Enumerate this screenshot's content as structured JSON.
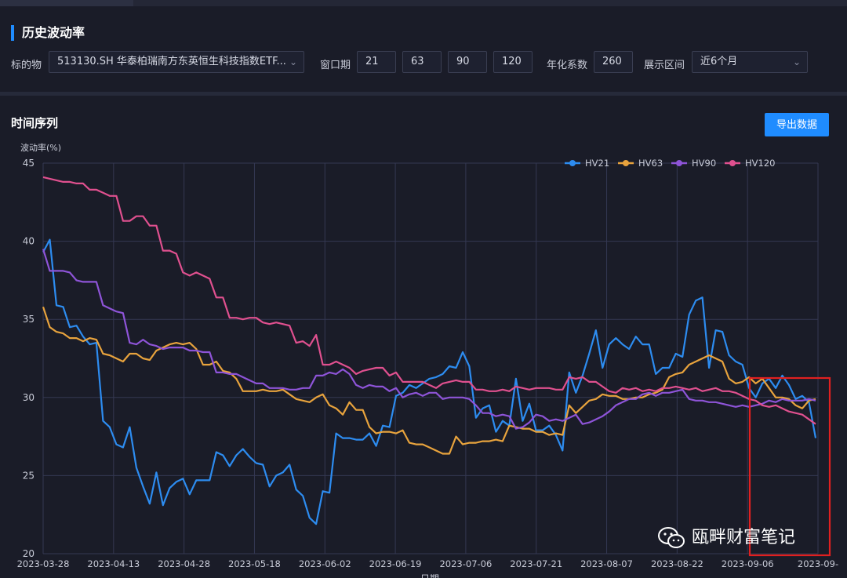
{
  "section": {
    "title": "历史波动率"
  },
  "filters": {
    "underlying_label": "标的物",
    "underlying_value": "513130.SH 华泰柏瑞南方东英恒生科技指数ETF...",
    "window_label": "窗口期",
    "windows": [
      "21",
      "63",
      "90",
      "120"
    ],
    "annual_label": "年化系数",
    "annual_value": "260",
    "range_label": "展示区间",
    "range_value": "近6个月"
  },
  "timeseries": {
    "title": "时间序列",
    "export_label": "导出数据"
  },
  "watermark": {
    "text": "瓯畔财富笔记"
  },
  "colors": {
    "accent": "#1f8cff",
    "hv21": "#2d8cf0",
    "hv63": "#e8a33d",
    "hv90": "#8e54d8",
    "hv120": "#e0508f",
    "highlight_box": "#e02020"
  },
  "chart_data": {
    "type": "line",
    "ylabel": "波动率(%)",
    "xlabel": "日期",
    "ylim": [
      20,
      45
    ],
    "yticks": [
      20,
      25,
      30,
      35,
      40,
      45
    ],
    "xtick_labels": [
      "2023-03-28",
      "2023-04-13",
      "2023-04-28",
      "2023-05-18",
      "2023-06-02",
      "2023-06-19",
      "2023-07-06",
      "2023-07-21",
      "2023-08-07",
      "2023-08-22",
      "2023-09-06",
      "2023-09-"
    ],
    "grid": true,
    "legend_position": "top-right",
    "x_count": 117,
    "series": [
      {
        "name": "HV21",
        "color": "#2d8cf0",
        "values": [
          39.3,
          40.1,
          35.9,
          35.8,
          34.5,
          34.6,
          33.9,
          33.4,
          33.5,
          28.5,
          28.1,
          27.0,
          26.8,
          28.1,
          25.5,
          24.3,
          23.2,
          25.2,
          23.1,
          24.2,
          24.6,
          24.8,
          23.8,
          24.7,
          24.7,
          24.7,
          26.5,
          26.3,
          25.6,
          26.3,
          26.7,
          26.2,
          25.8,
          25.7,
          24.3,
          25.0,
          25.2,
          25.7,
          24.1,
          23.7,
          22.3,
          21.9,
          24.0,
          23.9,
          27.7,
          27.4,
          27.4,
          27.3,
          27.3,
          27.7,
          26.9,
          28.2,
          28.1,
          30.1,
          30.3,
          30.8,
          30.6,
          30.9,
          31.2,
          31.3,
          31.5,
          32.0,
          31.9,
          32.9,
          32.0,
          28.7,
          29.3,
          29.5,
          27.8,
          28.5,
          28.2,
          31.2,
          28.5,
          29.6,
          27.9,
          27.9,
          28.2,
          27.6,
          26.6,
          31.6,
          30.3,
          31.4,
          32.8,
          34.3,
          31.9,
          33.4,
          33.8,
          33.4,
          33.1,
          33.9,
          33.4,
          33.4,
          31.5,
          31.9,
          31.9,
          32.8,
          32.6,
          35.3,
          36.2,
          36.4,
          31.9,
          34.3,
          34.2,
          32.7,
          32.3,
          32.1,
          30.6,
          30.0,
          30.9,
          31.2,
          30.6,
          31.4,
          30.8,
          29.9,
          30.1,
          29.7,
          27.4
        ]
      },
      {
        "name": "HV63",
        "color": "#e8a33d",
        "values": [
          35.8,
          34.5,
          34.2,
          34.1,
          33.8,
          33.8,
          33.6,
          33.8,
          33.7,
          32.8,
          32.7,
          32.5,
          32.3,
          32.8,
          32.8,
          32.5,
          32.4,
          33.0,
          33.2,
          33.4,
          33.5,
          33.4,
          33.5,
          33.1,
          32.1,
          32.1,
          32.3,
          31.7,
          31.6,
          31.2,
          30.4,
          30.4,
          30.4,
          30.5,
          30.4,
          30.4,
          30.5,
          30.2,
          29.9,
          29.8,
          29.7,
          30.0,
          30.2,
          29.5,
          29.3,
          28.9,
          29.7,
          29.2,
          29.2,
          28.1,
          27.7,
          27.8,
          27.8,
          27.7,
          27.9,
          27.1,
          27.0,
          27.0,
          26.8,
          26.6,
          26.4,
          26.4,
          27.5,
          27.0,
          27.1,
          27.1,
          27.2,
          27.2,
          27.3,
          27.2,
          28.2,
          28.1,
          28.0,
          28.0,
          27.8,
          27.8,
          27.6,
          27.7,
          27.6,
          29.5,
          29.0,
          29.4,
          29.8,
          29.9,
          30.2,
          30.1,
          30.1,
          29.9,
          29.9,
          30.0,
          30.0,
          30.2,
          30.3,
          30.5,
          31.3,
          31.5,
          31.6,
          32.1,
          32.3,
          32.5,
          32.7,
          32.5,
          32.3,
          31.2,
          30.9,
          31.0,
          31.3,
          30.9,
          31.2,
          30.6,
          30.0,
          30.0,
          29.9,
          29.5,
          29.3,
          29.8,
          29.9
        ]
      },
      {
        "name": "HV90",
        "color": "#8e54d8",
        "values": [
          39.5,
          38.1,
          38.1,
          38.1,
          38.0,
          37.5,
          37.4,
          37.4,
          37.4,
          35.9,
          35.7,
          35.5,
          35.4,
          33.5,
          33.4,
          33.7,
          33.4,
          33.3,
          33.1,
          33.2,
          33.2,
          33.2,
          33.0,
          33.0,
          32.9,
          32.9,
          31.6,
          31.6,
          31.5,
          31.5,
          31.3,
          31.1,
          30.9,
          30.9,
          30.6,
          30.6,
          30.6,
          30.5,
          30.5,
          30.6,
          30.6,
          31.4,
          31.4,
          31.6,
          31.5,
          31.8,
          31.5,
          30.8,
          30.6,
          30.8,
          30.7,
          30.7,
          30.4,
          30.6,
          30.0,
          30.2,
          30.3,
          30.1,
          30.3,
          30.3,
          29.9,
          30.0,
          30.0,
          30.0,
          29.9,
          29.5,
          29.0,
          29.0,
          28.8,
          28.9,
          28.8,
          28.0,
          28.1,
          28.4,
          28.9,
          28.8,
          28.5,
          28.6,
          28.5,
          28.7,
          28.9,
          28.3,
          28.4,
          28.6,
          28.8,
          29.1,
          29.5,
          29.7,
          29.9,
          29.9,
          30.2,
          30.3,
          30.1,
          30.3,
          30.3,
          30.4,
          30.5,
          29.9,
          29.8,
          29.8,
          29.7,
          29.7,
          29.6,
          29.5,
          29.4,
          29.5,
          29.4,
          29.5,
          29.6,
          29.8,
          29.7,
          29.9,
          29.8,
          29.8,
          29.8,
          29.9,
          29.8
        ]
      },
      {
        "name": "HV120",
        "color": "#e0508f",
        "values": [
          44.1,
          44.0,
          43.9,
          43.8,
          43.8,
          43.7,
          43.7,
          43.3,
          43.3,
          43.1,
          42.9,
          42.9,
          41.3,
          41.3,
          41.6,
          41.6,
          41.0,
          41.0,
          39.4,
          39.4,
          39.2,
          38.0,
          37.8,
          38.0,
          37.8,
          37.6,
          36.4,
          36.4,
          35.1,
          35.1,
          35.0,
          35.1,
          35.1,
          34.8,
          34.7,
          34.8,
          34.7,
          34.6,
          33.5,
          33.6,
          33.3,
          34.0,
          32.1,
          32.1,
          32.3,
          32.1,
          31.9,
          31.5,
          31.7,
          31.8,
          31.9,
          31.9,
          31.4,
          31.6,
          31.0,
          31.0,
          31.0,
          31.0,
          30.8,
          30.6,
          30.9,
          31.0,
          31.1,
          31.0,
          31.0,
          30.5,
          30.5,
          30.4,
          30.4,
          30.5,
          30.4,
          30.7,
          30.6,
          30.5,
          30.6,
          30.6,
          30.6,
          30.5,
          30.5,
          31.3,
          31.2,
          31.3,
          31.0,
          31.0,
          30.7,
          30.4,
          30.3,
          30.6,
          30.5,
          30.6,
          30.4,
          30.5,
          30.4,
          30.6,
          30.6,
          30.7,
          30.6,
          30.5,
          30.6,
          30.4,
          30.5,
          30.6,
          30.4,
          30.4,
          30.3,
          30.1,
          29.9,
          29.8,
          29.5,
          29.4,
          29.5,
          29.3,
          29.1,
          29.0,
          28.9,
          28.6,
          28.3
        ]
      }
    ]
  }
}
